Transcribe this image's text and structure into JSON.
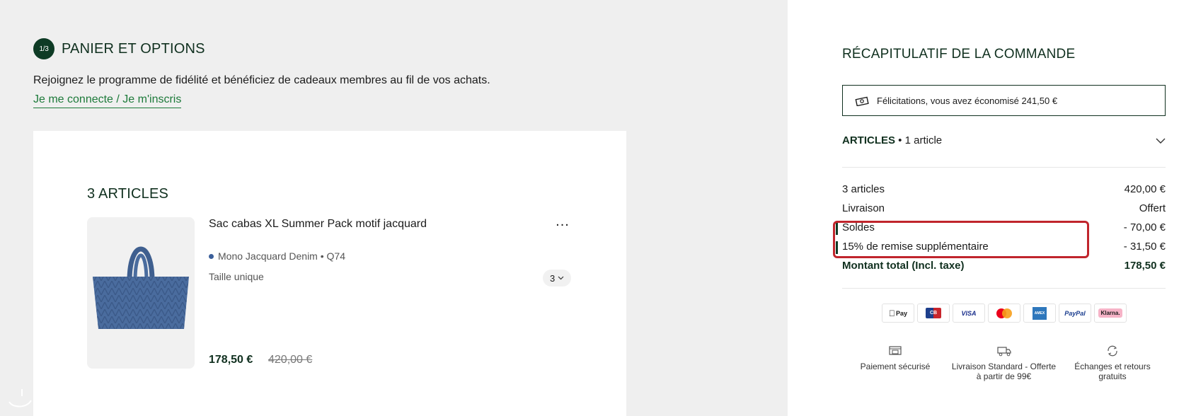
{
  "cart": {
    "step_badge": "1/3",
    "step_title": "PANIER ET OPTIONS",
    "loyalty_text": "Rejoignez le programme de fidélité et bénéficiez de cadeaux membres au fil de vos achats.",
    "loyalty_link": "Je me connecte / Je m'inscris",
    "articles_title": "3 ARTICLES",
    "item": {
      "name": "Sac cabas XL Summer Pack motif jacquard",
      "more_label": "...",
      "variant": "Mono Jacquard Denim • Q74",
      "size": "Taille unique",
      "quantity": "3",
      "price": "178,50 €",
      "old_price": "420,00 €"
    }
  },
  "summary": {
    "title": "RÉCAPITULATIF DE LA COMMANDE",
    "savings": "Félicitations, vous avez économisé 241,50 €",
    "articles_label": "ARTICLES",
    "articles_count": "• 1 article",
    "lines": [
      {
        "label": "3 articles",
        "value": "420,00 €"
      },
      {
        "label": "Livraison",
        "value": "Offert"
      },
      {
        "label": "Soldes",
        "value": "- 70,00 €"
      },
      {
        "label": "15% de remise supplémentaire",
        "value": "- 31,50 €"
      }
    ],
    "total": {
      "label": "Montant total (Incl. taxe)",
      "value": "178,50 €"
    },
    "payments": [
      "Pay",
      "CB",
      "VISA",
      "",
      "AMEX",
      "PayPal",
      "Klarna."
    ],
    "features": [
      {
        "label": "Paiement sécurisé",
        "icon": "secure-payment-icon"
      },
      {
        "label": "Livraison Standard - Offerte à partir de 99€",
        "icon": "delivery-truck-icon"
      },
      {
        "label": "Échanges et retours gratuits",
        "icon": "returns-icon"
      }
    ]
  },
  "colors": {
    "brand_green": "#0e3b25",
    "link_green": "#1d7a3a",
    "highlight_red": "#c0252c"
  }
}
